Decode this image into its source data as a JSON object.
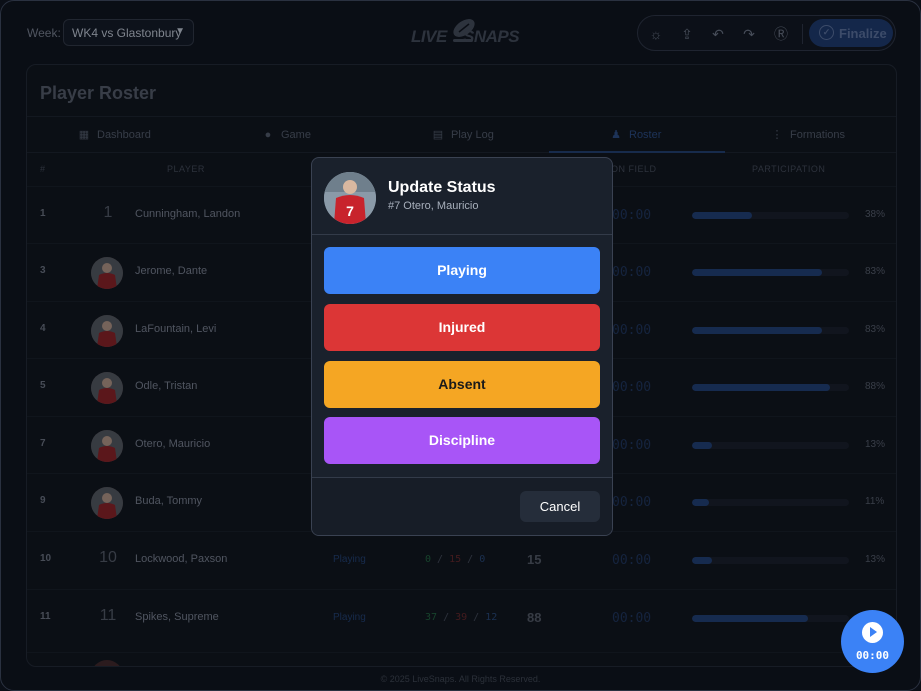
{
  "topbar": {
    "week_label": "Week:",
    "week_value": "WK4 vs Glastonbury",
    "logo_left": "LIVE",
    "logo_right": "SNAPS",
    "finalize_label": "Finalize"
  },
  "roster": {
    "title": "Player Roster",
    "tabs": [
      {
        "label": "Dashboard",
        "icon": "dashboard-icon"
      },
      {
        "label": "Game",
        "icon": "football-icon"
      },
      {
        "label": "Play Log",
        "icon": "list-icon"
      },
      {
        "label": "Roster",
        "icon": "shirt-icon",
        "active": true
      },
      {
        "label": "Formations",
        "icon": "formation-icon"
      }
    ],
    "columns": {
      "num": "#",
      "player": "PLAYER",
      "on_field": "ON FIELD",
      "participation": "PARTICIPATION"
    },
    "rows": [
      {
        "num": "1",
        "jersey": "1",
        "name": "Cunningham, Landon",
        "time": "00:00",
        "pct": "38%",
        "pct_value": 38,
        "photo": false
      },
      {
        "num": "3",
        "name": "Jerome, Dante",
        "time": "00:00",
        "pct": "83%",
        "pct_value": 83,
        "photo": true
      },
      {
        "num": "4",
        "name": "LaFountain, Levi",
        "time": "00:00",
        "pct": "83%",
        "pct_value": 83,
        "photo": true
      },
      {
        "num": "5",
        "name": "Odle, Tristan",
        "time": "00:00",
        "pct": "88%",
        "pct_value": 88,
        "photo": true
      },
      {
        "num": "7",
        "name": "Otero, Mauricio",
        "time": "00:00",
        "pct": "13%",
        "pct_value": 13,
        "photo": true
      },
      {
        "num": "9",
        "name": "Buda, Tommy",
        "time": "00:00",
        "pct": "11%",
        "pct_value": 11,
        "photo": true
      },
      {
        "num": "10",
        "jersey": "10",
        "name": "Lockwood, Paxson",
        "status": "Playing",
        "s1": "0",
        "s2": "15",
        "s3": "0",
        "snaps": "15",
        "time": "00:00",
        "pct": "13%",
        "pct_value": 13,
        "photo": false
      },
      {
        "num": "11",
        "jersey": "11",
        "name": "Spikes, Supreme",
        "status": "Playing",
        "s1": "37",
        "s2": "39",
        "s3": "12",
        "snaps": "88",
        "time": "00:00",
        "pct": "74%",
        "pct_value": 74,
        "photo": false
      }
    ]
  },
  "footer": "© 2025 LiveSnaps. All Rights Reserved.",
  "timer": "00:00",
  "modal": {
    "title": "Update Status",
    "subtitle": "#7 Otero, Mauricio",
    "jersey_number": "7",
    "buttons": [
      {
        "label": "Playing",
        "bg": "#3b82f6",
        "fg": "#ffffff"
      },
      {
        "label": "Injured",
        "bg": "#dc3636",
        "fg": "#ffffff"
      },
      {
        "label": "Absent",
        "bg": "#f5a623",
        "fg": "#1a1a1a"
      },
      {
        "label": "Discipline",
        "bg": "#a855f7",
        "fg": "#ffffff"
      }
    ],
    "cancel_label": "Cancel"
  }
}
